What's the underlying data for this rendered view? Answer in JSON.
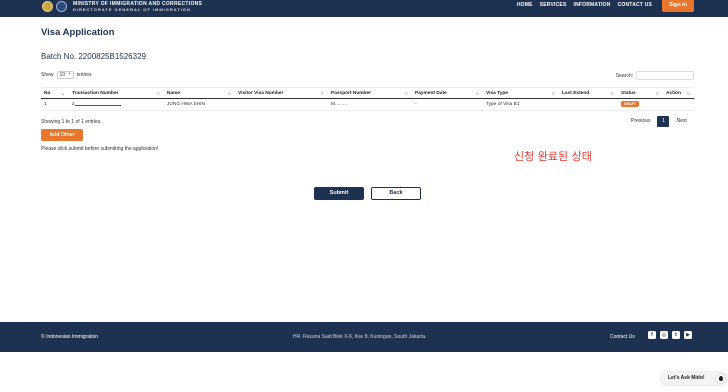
{
  "header": {
    "ministry_line1": "MINISTRY OF IMMIGRATION AND CORRECTIONS",
    "ministry_line2": "DIRECTORATE GENERAL OF IMMIGRATION",
    "nav": [
      "HOME",
      "SERVICES",
      "INFORMATION",
      "CONTACT US"
    ],
    "signin_label": "Sign In"
  },
  "page": {
    "title": "Visa Application",
    "batch": "Batch No. 2200825B1526329"
  },
  "table_controls": {
    "show_label": "Show",
    "page_size": "10",
    "entries_label": "entries",
    "search_label": "Search:"
  },
  "table": {
    "columns": [
      "No",
      "Transaction Number",
      "Name",
      "Visitor Visa Number",
      "Passport Number",
      "Payment Date",
      "Visa Type",
      "Last Extend",
      "Status",
      "Action"
    ],
    "rows": [
      {
        "no": "1",
        "transaction_number": "2",
        "name": "JUNG HWA SHIN",
        "visitor_visa_number": "",
        "passport_number": "M.........",
        "payment_date": "-",
        "visa_type": "Type of Visa B1",
        "last_extend": "",
        "status": "DRAFT",
        "action": ""
      }
    ]
  },
  "pagination": {
    "info": "Showing 1 to 1 of 1 entries",
    "previous": "Previous",
    "current": "1",
    "next": "Next"
  },
  "actions": {
    "add_other": "Add Other",
    "note": "Please click submit before submitting the application!",
    "submit": "Submit",
    "back": "Back"
  },
  "annotation": "신청 완료된 상태",
  "footer": {
    "copyright": "© Indonesian Immigration",
    "address": "HR. Rasuna Said Blok X-6, Kav 8, Kuningan, South Jakarta.",
    "contact": "Contact Us",
    "socials": [
      "facebook-icon",
      "instagram-icon",
      "twitter-icon",
      "youtube-icon"
    ]
  },
  "chat": {
    "label": "Let's Ask Mido!"
  },
  "colors": {
    "navy": "#1f3150",
    "orange": "#e8762c",
    "annotation_red": "#e53935"
  }
}
